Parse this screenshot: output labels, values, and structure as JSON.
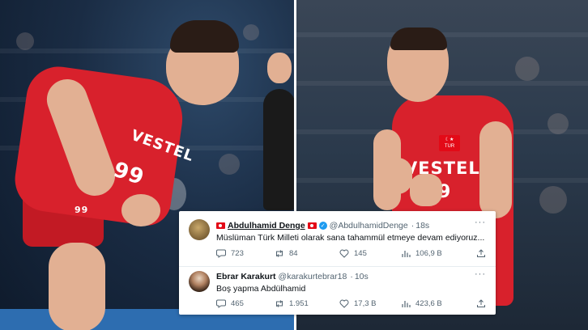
{
  "tweets": [
    {
      "display_name": "Abdulhamid Denge",
      "handle": "@AbdulhamidDenge",
      "time": "18s",
      "text": "Müslüman Türk Milleti olarak sana tahammül etmeye devam ediyoruz...",
      "more": "···",
      "replies": "723",
      "retweets": "84",
      "likes": "145",
      "views": "106,9 B",
      "verified": true,
      "flags": true
    },
    {
      "display_name": "Ebrar Karakurt",
      "handle": "@karakurtebrar18",
      "time": "10s",
      "text": "Boş yapma Abdülhamid",
      "more": "···",
      "replies": "465",
      "retweets": "1.951",
      "likes": "17,3 B",
      "views": "423,6 B",
      "verified": false,
      "flags": false
    }
  ],
  "photos": {
    "left_jersey_number": "99",
    "left_jersey_brand": "VESTEL",
    "left_shorts_number": "99",
    "right_jersey_brand": "VESTEL",
    "right_badge": "TUR",
    "right_jersey_number": "9"
  },
  "colors": {
    "jersey_red": "#d8212c",
    "verified_blue": "#1d9bf0",
    "flag_red": "#e30a17"
  },
  "icons": [
    "reply-icon",
    "retweet-icon",
    "like-icon",
    "views-icon",
    "share-icon",
    "verified-icon",
    "turkey-flag-icon",
    "more-icon"
  ]
}
